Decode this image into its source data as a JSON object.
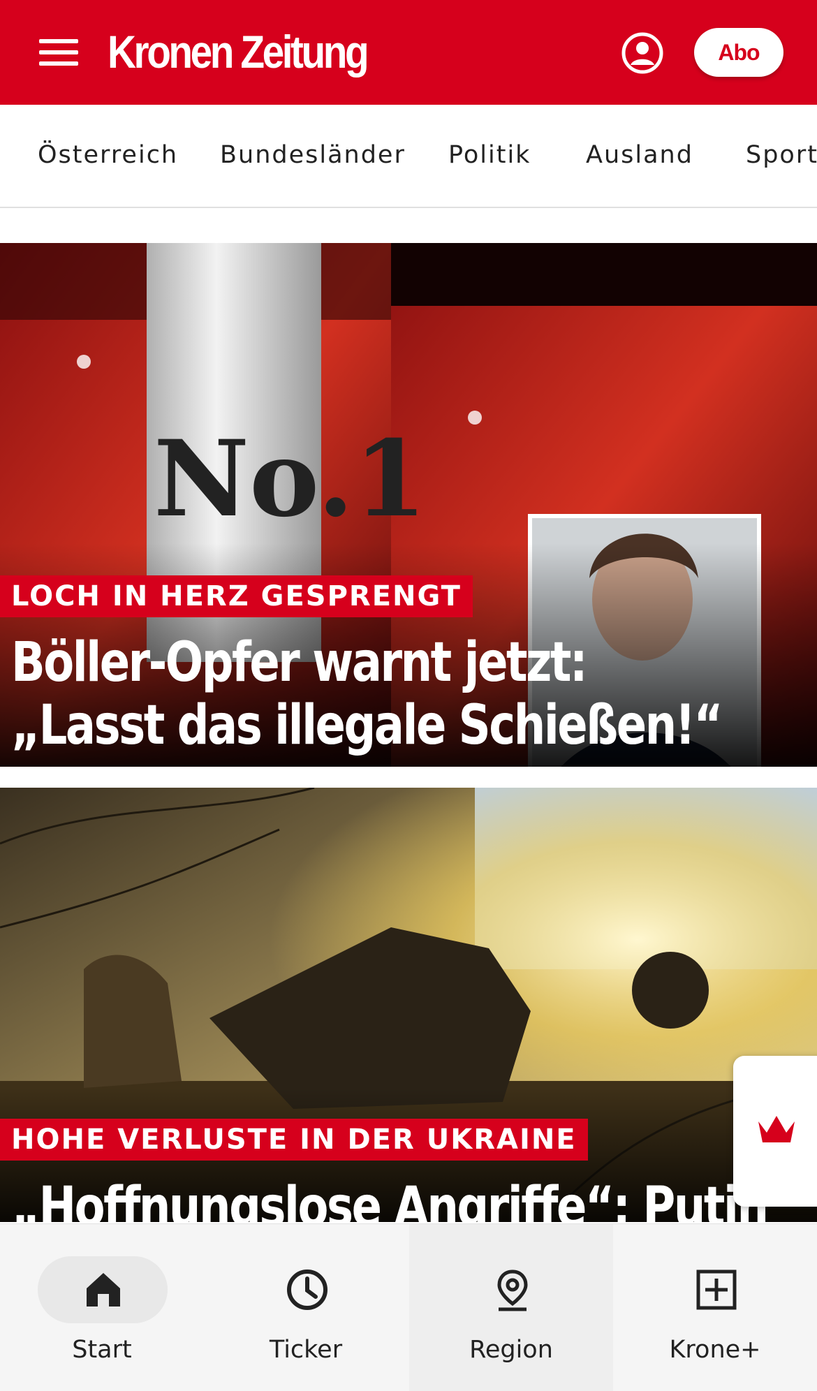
{
  "header": {
    "logo_text": "Kronen Zeitung",
    "abo_label": "Abo",
    "brand_color": "#d6001c"
  },
  "categories": [
    "Österreich",
    "Bundesländer",
    "Politik",
    "Ausland",
    "Sport"
  ],
  "articles": [
    {
      "kicker": "LOCH IN HERZ GESPRENGT",
      "headline_line1": "Böller-Opfer warnt jetzt:",
      "headline_line2": "„Lasst das illegale Schießen!“"
    },
    {
      "kicker": "HOHE VERLUSTE IN DER UKRAINE",
      "headline_line1": "„Hoffnungslose Angriffe“: Putin"
    }
  ],
  "bottom_nav": {
    "items": [
      {
        "label": "Start",
        "icon": "home-icon",
        "active": true
      },
      {
        "label": "Ticker",
        "icon": "clock-icon"
      },
      {
        "label": "Region",
        "icon": "location-pin-icon"
      },
      {
        "label": "Krone+",
        "icon": "plus-square-icon"
      }
    ]
  }
}
